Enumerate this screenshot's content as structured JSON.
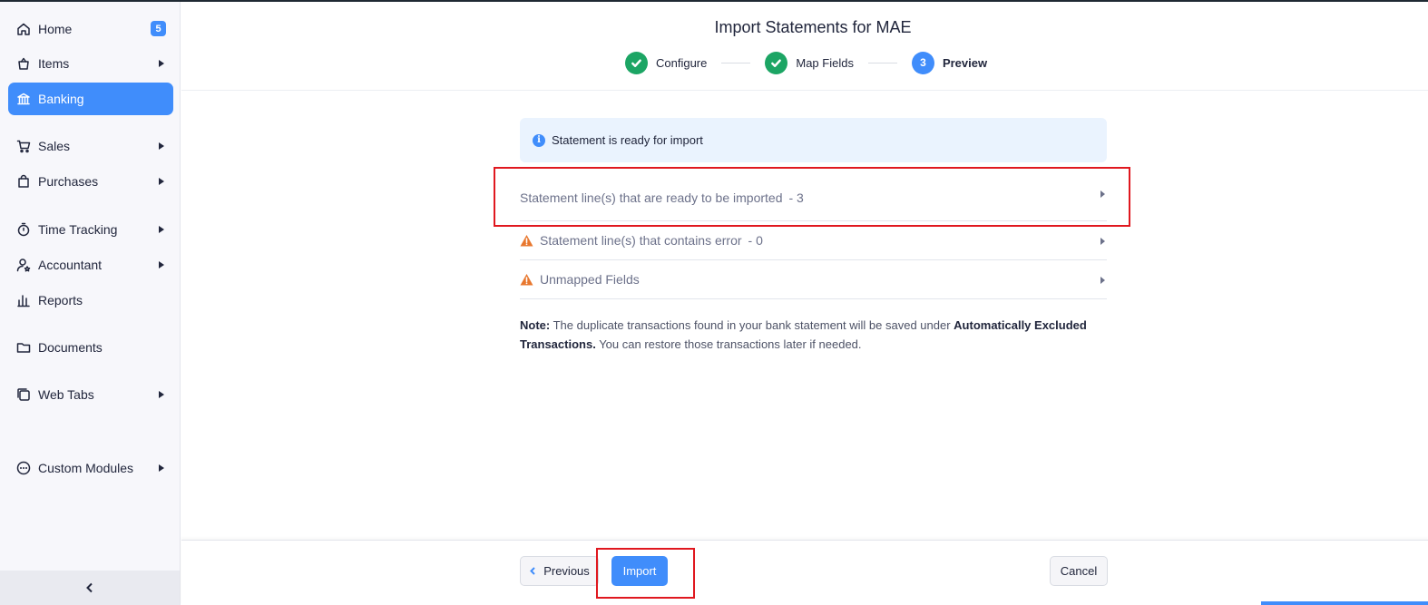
{
  "sidebar": {
    "items": [
      {
        "label": "Home",
        "icon": "home-icon",
        "badge": "5"
      },
      {
        "label": "Items",
        "icon": "basket-icon"
      },
      {
        "label": "Banking",
        "icon": "bank-icon"
      },
      {
        "label": "Sales",
        "icon": "cart-icon"
      },
      {
        "label": "Purchases",
        "icon": "bag-icon"
      },
      {
        "label": "Time Tracking",
        "icon": "stopwatch-icon"
      },
      {
        "label": "Accountant",
        "icon": "accountant-icon"
      },
      {
        "label": "Reports",
        "icon": "bar-chart-icon"
      },
      {
        "label": "Documents",
        "icon": "folder-icon"
      },
      {
        "label": "Web Tabs",
        "icon": "tabs-icon"
      },
      {
        "label": "Custom Modules",
        "icon": "ellipsis-circle-icon"
      }
    ],
    "active": "Banking"
  },
  "header": {
    "title": "Import Statements for MAE",
    "steps": [
      {
        "label": "Configure",
        "state": "done"
      },
      {
        "label": "Map Fields",
        "state": "done"
      },
      {
        "label": "Preview",
        "state": "current",
        "number": "3"
      }
    ]
  },
  "main": {
    "info_banner": "Statement is ready for import",
    "rows": [
      {
        "label": "Statement line(s) that are ready to be imported",
        "count": "- 3",
        "warning": false
      },
      {
        "label": "Statement line(s) that contains error",
        "count": "- 0",
        "warning": true
      },
      {
        "label": "Unmapped Fields",
        "count": "",
        "warning": true
      }
    ],
    "note": {
      "prefix": "Note:",
      "text_1": "The duplicate transactions found in your bank statement will be saved under",
      "bold": "Automatically Excluded Transactions.",
      "text_2": "You can restore those transactions later if needed."
    }
  },
  "footer": {
    "previous_label": "Previous",
    "import_label": "Import",
    "cancel_label": "Cancel"
  },
  "colors": {
    "accent": "#408dfb",
    "success": "#1ca564",
    "warning": "#e8772e",
    "highlight": "#e0181f"
  }
}
